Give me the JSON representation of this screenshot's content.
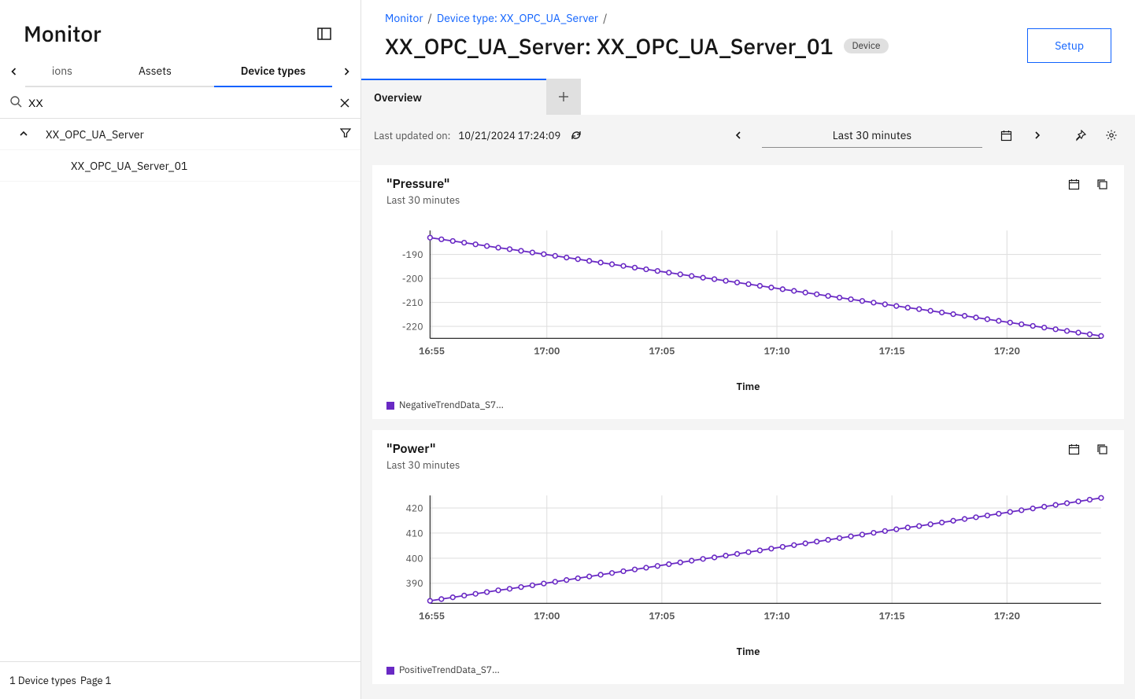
{
  "sidebar": {
    "title": "Monitor",
    "tabs": {
      "partial_left": "ions",
      "assets": "Assets",
      "device_types": "Device types"
    },
    "search_value": "XX",
    "tree": {
      "parent": "XX_OPC_UA_Server",
      "child": "XX_OPC_UA_Server_01"
    },
    "footer_count": "1 Device types",
    "footer_page": "Page 1"
  },
  "breadcrumbs": {
    "monitor": "Monitor",
    "dtype": "Device type: XX_OPC_UA_Server"
  },
  "page_title": "XX_OPC_UA_Server: XX_OPC_UA_Server_01",
  "tag": "Device",
  "setup": "Setup",
  "content_tab": "Overview",
  "toolbar": {
    "label": "Last updated on:",
    "value": "10/21/2024 17:24:09",
    "range": "Last 30 minutes"
  },
  "cards": {
    "pressure": {
      "title": "\"Pressure\"",
      "sub": "Last 30 minutes",
      "xlabel": "Time",
      "legend": "NegativeTrendData_S7…"
    },
    "power": {
      "title": "\"Power\"",
      "sub": "Last 30 minutes",
      "xlabel": "Time",
      "legend": "PositiveTrendData_S7…"
    }
  },
  "chart_data": [
    {
      "type": "line",
      "title": "\"Pressure\"",
      "xlabel": "Time",
      "ylabel": "",
      "ylim": [
        -225,
        -180
      ],
      "x_ticks": [
        "16:55",
        "17:00",
        "17:05",
        "17:10",
        "17:15",
        "17:20"
      ],
      "y_ticks": [
        -190,
        -200,
        -210,
        -220
      ],
      "series": [
        {
          "name": "NegativeTrendData_S7…",
          "color": "#6929c4",
          "x": [
            "16:54",
            "16:54.5",
            "16:55",
            "16:55.5",
            "16:56",
            "16:56.5",
            "16:57",
            "16:57.5",
            "16:58",
            "16:58.5",
            "16:59",
            "16:59.5",
            "17:00",
            "17:00.5",
            "17:01",
            "17:01.5",
            "17:02",
            "17:02.5",
            "17:03",
            "17:03.5",
            "17:04",
            "17:04.5",
            "17:05",
            "17:05.5",
            "17:06",
            "17:06.5",
            "17:07",
            "17:07.5",
            "17:08",
            "17:08.5",
            "17:09",
            "17:09.5",
            "17:10",
            "17:10.5",
            "17:11",
            "17:11.5",
            "17:12",
            "17:12.5",
            "17:13",
            "17:13.5",
            "17:14",
            "17:14.5",
            "17:15",
            "17:15.5",
            "17:16",
            "17:16.5",
            "17:17",
            "17:17.5",
            "17:18",
            "17:18.5",
            "17:19",
            "17:19.5",
            "17:20",
            "17:20.5",
            "17:21",
            "17:21.5",
            "17:22",
            "17:22.5",
            "17:23",
            "17:23.5"
          ],
          "values": [
            -183.0,
            -183.7,
            -184.4,
            -185.1,
            -185.8,
            -186.5,
            -187.2,
            -187.8,
            -188.5,
            -189.2,
            -189.9,
            -190.6,
            -191.3,
            -192.0,
            -192.7,
            -193.4,
            -194.1,
            -194.8,
            -195.5,
            -196.2,
            -196.9,
            -197.6,
            -198.3,
            -199.0,
            -199.7,
            -200.3,
            -201.0,
            -201.7,
            -202.4,
            -203.1,
            -203.8,
            -204.5,
            -205.2,
            -205.9,
            -206.6,
            -207.3,
            -208.0,
            -208.7,
            -209.4,
            -210.1,
            -210.8,
            -211.5,
            -212.2,
            -212.8,
            -213.5,
            -214.2,
            -214.9,
            -215.6,
            -216.3,
            -217.0,
            -217.7,
            -218.4,
            -219.1,
            -219.8,
            -220.5,
            -221.2,
            -221.9,
            -222.6,
            -223.3,
            -224.0
          ]
        }
      ]
    },
    {
      "type": "line",
      "title": "\"Power\"",
      "xlabel": "Time",
      "ylabel": "",
      "ylim": [
        382,
        425
      ],
      "x_ticks": [
        "16:55",
        "17:00",
        "17:05",
        "17:10",
        "17:15",
        "17:20"
      ],
      "y_ticks": [
        390,
        400,
        410,
        420
      ],
      "series": [
        {
          "name": "PositiveTrendData_S7…",
          "color": "#6929c4",
          "x": [
            "16:54",
            "16:54.5",
            "16:55",
            "16:55.5",
            "16:56",
            "16:56.5",
            "16:57",
            "16:57.5",
            "16:58",
            "16:58.5",
            "16:59",
            "16:59.5",
            "17:00",
            "17:00.5",
            "17:01",
            "17:01.5",
            "17:02",
            "17:02.5",
            "17:03",
            "17:03.5",
            "17:04",
            "17:04.5",
            "17:05",
            "17:05.5",
            "17:06",
            "17:06.5",
            "17:07",
            "17:07.5",
            "17:08",
            "17:08.5",
            "17:09",
            "17:09.5",
            "17:10",
            "17:10.5",
            "17:11",
            "17:11.5",
            "17:12",
            "17:12.5",
            "17:13",
            "17:13.5",
            "17:14",
            "17:14.5",
            "17:15",
            "17:15.5",
            "17:16",
            "17:16.5",
            "17:17",
            "17:17.5",
            "17:18",
            "17:18.5",
            "17:19",
            "17:19.5",
            "17:20",
            "17:20.5",
            "17:21",
            "17:21.5",
            "17:22",
            "17:22.5",
            "17:23",
            "17:23.5"
          ],
          "values": [
            383.0,
            383.7,
            384.4,
            385.1,
            385.8,
            386.5,
            387.2,
            387.8,
            388.5,
            389.2,
            389.9,
            390.6,
            391.3,
            392.0,
            392.7,
            393.4,
            394.1,
            394.8,
            395.5,
            396.2,
            396.9,
            397.6,
            398.3,
            399.0,
            399.7,
            400.3,
            401.0,
            401.7,
            402.4,
            403.1,
            403.8,
            404.5,
            405.2,
            405.9,
            406.6,
            407.3,
            408.0,
            408.7,
            409.4,
            410.1,
            410.8,
            411.5,
            412.2,
            412.8,
            413.5,
            414.2,
            414.9,
            415.6,
            416.3,
            417.0,
            417.7,
            418.4,
            419.1,
            419.8,
            420.5,
            421.2,
            421.9,
            422.6,
            423.3,
            424.0
          ]
        }
      ]
    }
  ]
}
